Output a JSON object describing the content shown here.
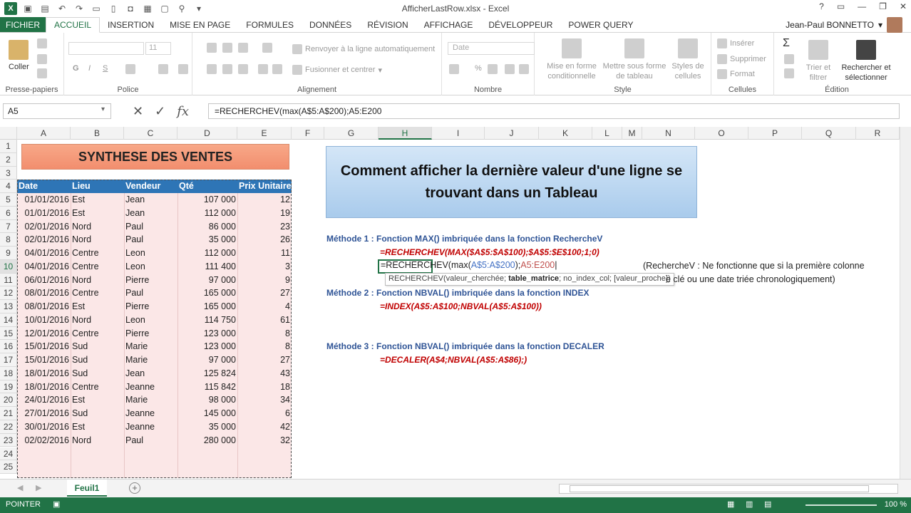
{
  "window": {
    "title": "AfficherLastRow.xlsx - Excel",
    "controls": [
      "?",
      "—",
      "❐",
      "✕"
    ]
  },
  "ribbon_tabs": [
    "FICHIER",
    "ACCUEIL",
    "INSERTION",
    "MISE EN PAGE",
    "FORMULES",
    "DONNÉES",
    "RÉVISION",
    "AFFICHAGE",
    "DÉVELOPPEUR",
    "POWER QUERY"
  ],
  "user": "Jean-Paul BONNETTO",
  "ribbon": {
    "clipboard": {
      "label": "Presse-papiers",
      "paste": "Coller"
    },
    "font": {
      "label": "Police",
      "size": "11",
      "bold": "G",
      "italic": "I",
      "underline": "S"
    },
    "alignment": {
      "label": "Alignement",
      "wrap": "Renvoyer à la ligne automatiquement",
      "merge": "Fusionner et centrer"
    },
    "number": {
      "label": "Nombre",
      "format": "Date"
    },
    "styles": {
      "label": "Style",
      "conditional": "Mise en forme conditionnelle",
      "as_table": "Mettre sous forme de tableau",
      "cell_styles": "Styles de cellules"
    },
    "cells": {
      "label": "Cellules",
      "insert": "Insérer",
      "delete": "Supprimer",
      "format": "Format"
    },
    "editing": {
      "label": "Édition",
      "sort": "Trier et filtrer",
      "find": "Rechercher et sélectionner"
    }
  },
  "formula_bar": {
    "name_box": "A5",
    "formula": "=RECHERCHEV(max(A$5:A$200);A5:E200"
  },
  "columns": [
    "A",
    "B",
    "C",
    "D",
    "E",
    "F",
    "G",
    "H",
    "I",
    "J",
    "K",
    "L",
    "M",
    "N",
    "O",
    "P",
    "Q",
    "R"
  ],
  "rows": [
    "1",
    "2",
    "3",
    "4",
    "5",
    "6",
    "7",
    "8",
    "9",
    "10",
    "11",
    "12",
    "13",
    "14",
    "15",
    "16",
    "17",
    "18",
    "19",
    "20",
    "21",
    "22",
    "23",
    "24",
    "25"
  ],
  "banner": "SYNTHESE DES VENTES",
  "table": {
    "headers": [
      "Date",
      "Lieu",
      "Vendeur",
      "Qté",
      "Prix Unitaire"
    ],
    "rows": [
      [
        "01/01/2016",
        "Est",
        "Jean",
        "107 000",
        "12"
      ],
      [
        "01/01/2016",
        "Est",
        "Jean",
        "112 000",
        "19"
      ],
      [
        "02/01/2016",
        "Nord",
        "Paul",
        "86 000",
        "23"
      ],
      [
        "02/01/2016",
        "Nord",
        "Paul",
        "35 000",
        "26"
      ],
      [
        "04/01/2016",
        "Centre",
        "Leon",
        "112 000",
        "11"
      ],
      [
        "04/01/2016",
        "Centre",
        "Leon",
        "111 400",
        "3"
      ],
      [
        "06/01/2016",
        "Nord",
        "Pierre",
        "97 000",
        "9"
      ],
      [
        "08/01/2016",
        "Centre",
        "Paul",
        "165 000",
        "27"
      ],
      [
        "08/01/2016",
        "Est",
        "Pierre",
        "165 000",
        "4"
      ],
      [
        "10/01/2016",
        "Nord",
        "Leon",
        "114 750",
        "61"
      ],
      [
        "12/01/2016",
        "Centre",
        "Pierre",
        "123 000",
        "8"
      ],
      [
        "15/01/2016",
        "Sud",
        "Marie",
        "123 000",
        "8"
      ],
      [
        "15/01/2016",
        "Sud",
        "Marie",
        "97 000",
        "27"
      ],
      [
        "18/01/2016",
        "Sud",
        "Jean",
        "125 824",
        "43"
      ],
      [
        "18/01/2016",
        "Centre",
        "Jeanne",
        "115 842",
        "18"
      ],
      [
        "24/01/2016",
        "Est",
        "Marie",
        "98 000",
        "34"
      ],
      [
        "27/01/2016",
        "Sud",
        "Jeanne",
        "145 000",
        "6"
      ],
      [
        "30/01/2016",
        "Est",
        "Jeanne",
        "35 000",
        "42"
      ],
      [
        "02/02/2016",
        "Nord",
        "Paul",
        "280 000",
        "32"
      ]
    ]
  },
  "callout": "Comment afficher la dernière valeur d'une ligne se trouvant dans un Tableau",
  "methods": {
    "m1_title": "Méthode 1 : Fonction MAX() imbriquée dans la fonction RechercheV",
    "m1_formula": "=RECHERCHEV(MAX($A$5:$A$100);$A$5:$E$100;1;0)",
    "editing_prefix": "=RECHERCHEV(max(",
    "editing_range1": "A$5:A$200",
    "editing_sep": ");",
    "editing_range2": "A5:E200",
    "tooltip_fn": "RECHERCHEV(valeur_cherchée; ",
    "tooltip_bold": "table_matrice",
    "tooltip_rest": "; no_index_col; [valeur_proche])",
    "note1": "(RechercheV : Ne fonctionne que si la première colonne",
    "note2": "e clé ou une date triée chronologiquement)",
    "m2_title": "Méthode 2 : Fonction NBVAL() imbriquée dans la fonction INDEX",
    "m2_formula": "=INDEX(A$5:A$100;NBVAL(A$5:A$100))",
    "m3_title": "Méthode 3 : Fonction NBVAL() imbriquée dans la fonction DECALER",
    "m3_formula": "=DECALER(A$4;NBVAL(A$5:A$86);)"
  },
  "sheet_tab": "Feuil1",
  "status": {
    "mode": "POINTER",
    "zoom": "100 %"
  },
  "colors": {
    "excel_green": "#217346",
    "table_header": "#2e75b6",
    "table_fill": "#fbe7e7",
    "banner": "#f4a184",
    "callout": "#bdd7ee",
    "method": "#2f5496",
    "formula_red": "#c00000"
  }
}
